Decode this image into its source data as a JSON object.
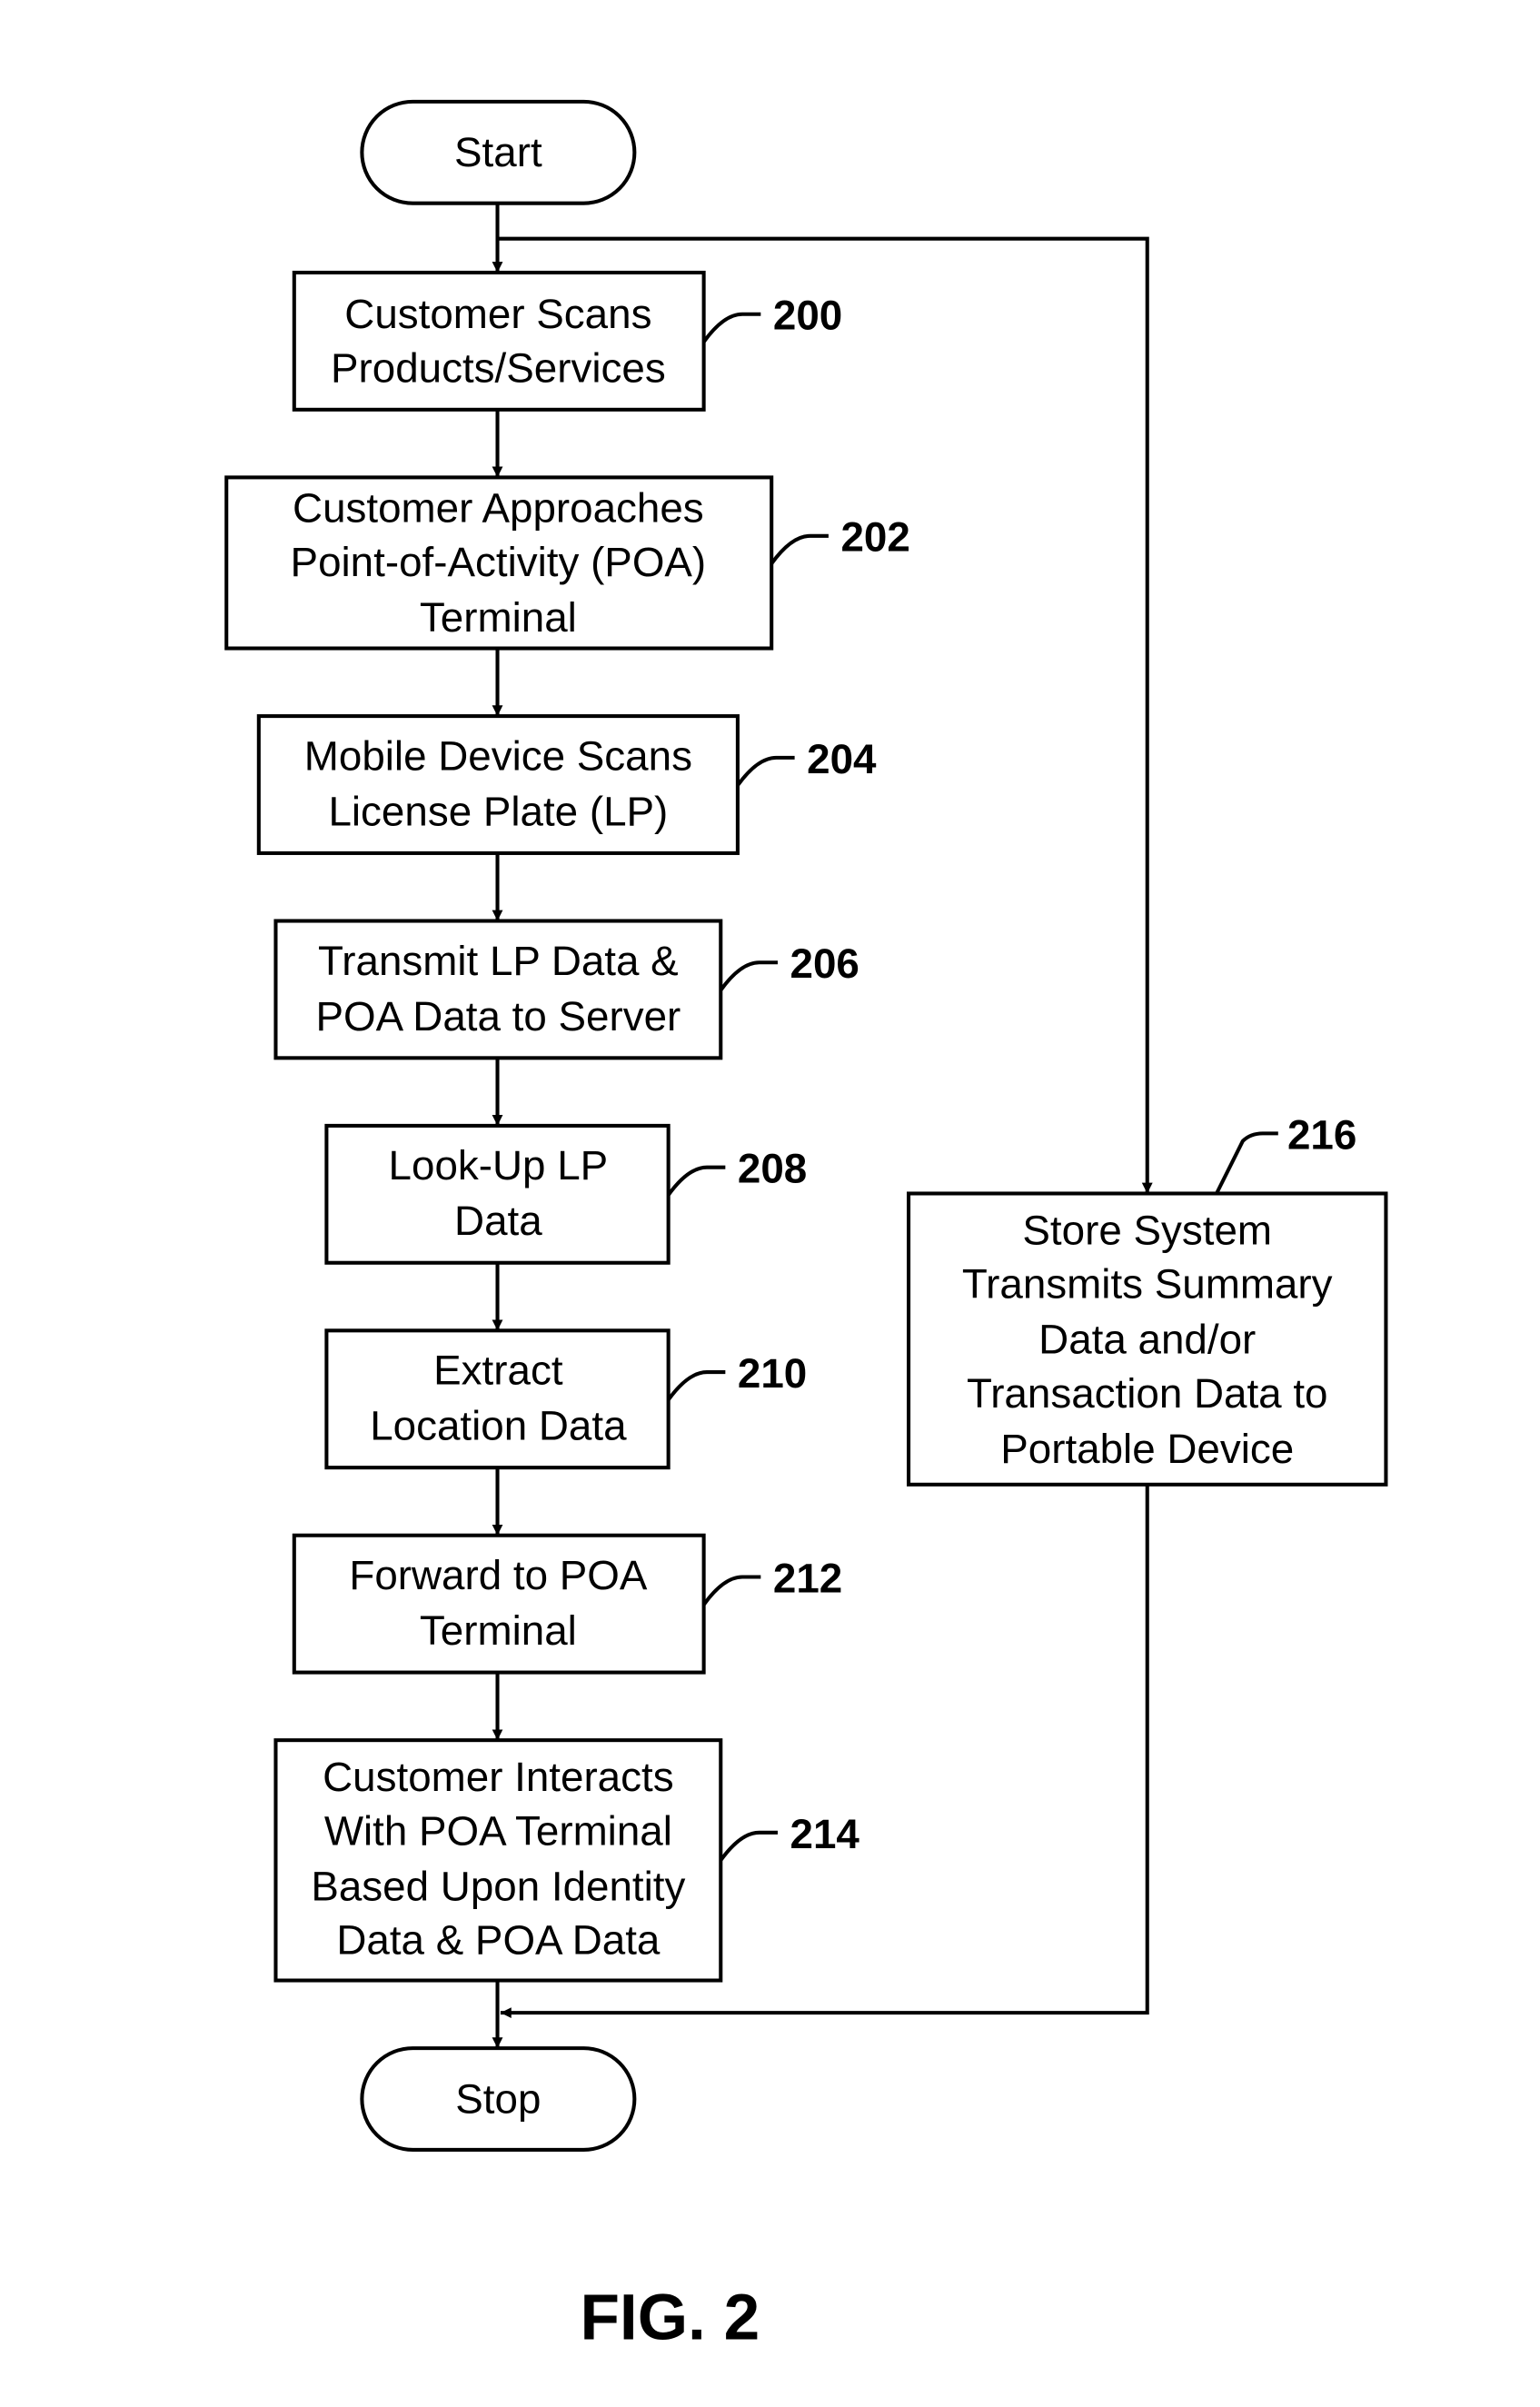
{
  "diagram": {
    "figure_label": "FIG. 2",
    "start": "Start",
    "stop": "Stop",
    "steps": [
      {
        "ref": "200",
        "lines": [
          "Customer Scans",
          "Products/Services"
        ]
      },
      {
        "ref": "202",
        "lines": [
          "Customer Approaches",
          "Point-of-Activity (POA)",
          "Terminal"
        ]
      },
      {
        "ref": "204",
        "lines": [
          "Mobile Device Scans",
          "License Plate (LP)"
        ]
      },
      {
        "ref": "206",
        "lines": [
          "Transmit LP Data &",
          "POA Data to Server"
        ]
      },
      {
        "ref": "208",
        "lines": [
          "Look-Up LP",
          "Data"
        ]
      },
      {
        "ref": "210",
        "lines": [
          "Extract",
          "Location Data"
        ]
      },
      {
        "ref": "212",
        "lines": [
          "Forward to POA",
          "Terminal"
        ]
      },
      {
        "ref": "214",
        "lines": [
          "Customer Interacts",
          "With POA Terminal",
          "Based Upon Identity",
          "Data & POA Data"
        ]
      },
      {
        "ref": "216",
        "lines": [
          "Store System",
          "Transmits Summary",
          "Data and/or",
          "Transaction Data to",
          "Portable Device"
        ]
      }
    ]
  }
}
